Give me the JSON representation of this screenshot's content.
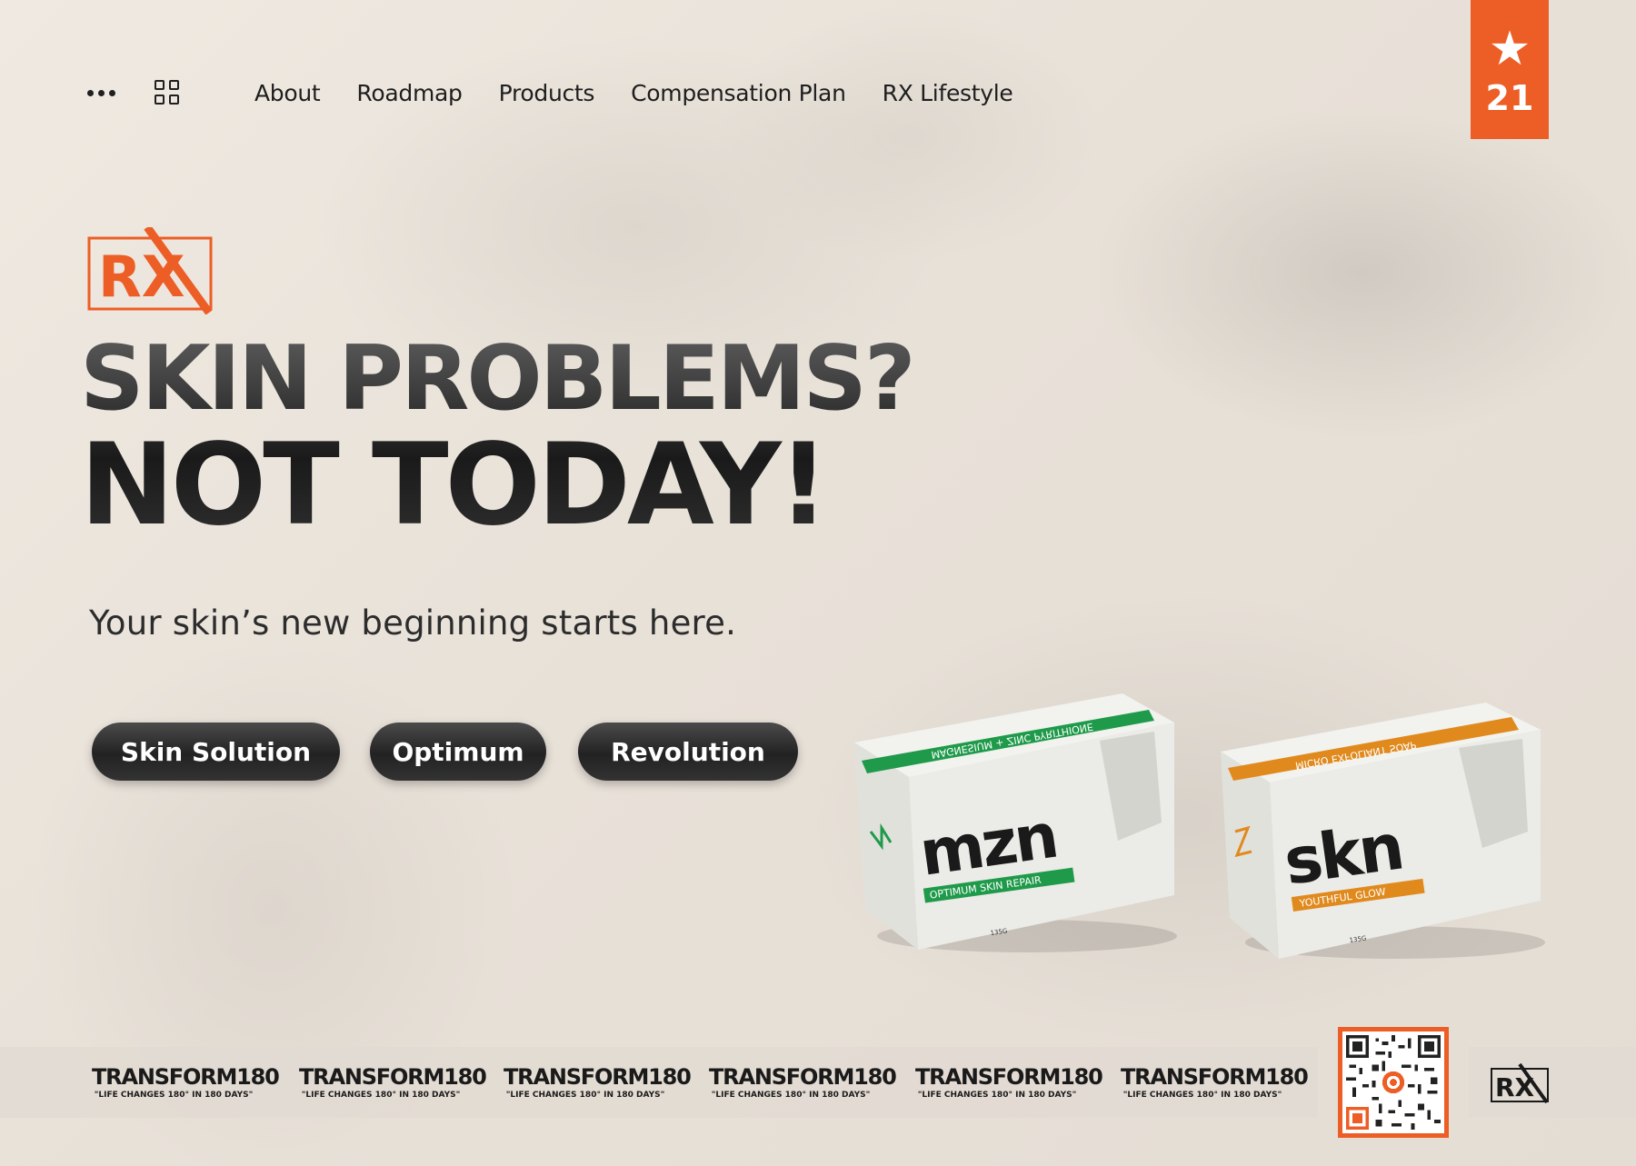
{
  "nav": {
    "links": [
      "About",
      "Roadmap",
      "Products",
      "Compensation Plan",
      "RX Lifestyle"
    ]
  },
  "rating_badge": {
    "value": "21",
    "icon": "star-icon"
  },
  "hero": {
    "logo_text": "RX",
    "headline_line1": "SKIN PROBLEMS?",
    "headline_line2": "NOT TODAY!",
    "tagline": "Your skin’s new beginning starts here."
  },
  "buttons": [
    "Skin Solution",
    "Optimum",
    "Revolution"
  ],
  "products": [
    {
      "brand": "mzn",
      "subtitle": "OPTIMUM SKIN REPAIR",
      "band_text": "MAGNESIUM + ZINC PYRITHIONE",
      "weight": "135G",
      "accent": "#1f9a4a"
    },
    {
      "brand": "skn",
      "subtitle": "YOUTHFUL GLOW",
      "band_text": "MICRO EXFOLIANT SOAP",
      "weight": "135G",
      "accent": "#e08a1e"
    }
  ],
  "transform_items": [
    {
      "title": "TRANSFORM180",
      "sub": "\"LIFE CHANGES 180° IN 180 DAYS\""
    },
    {
      "title": "TRANSFORM180",
      "sub": "\"LIFE CHANGES 180° IN 180 DAYS\""
    },
    {
      "title": "TRANSFORM180",
      "sub": "\"LIFE CHANGES 180° IN 180 DAYS\""
    },
    {
      "title": "TRANSFORM180",
      "sub": "\"LIFE CHANGES 180° IN 180 DAYS\""
    },
    {
      "title": "TRANSFORM180",
      "sub": "\"LIFE CHANGES 180° IN 180 DAYS\""
    },
    {
      "title": "TRANSFORM180",
      "sub": "\"LIFE CHANGES 180° IN 180 DAYS\""
    }
  ],
  "footer_logo_text": "RX",
  "colors": {
    "accent": "#ec5e25",
    "background": "#ebe5dc",
    "text": "#1f1f1f",
    "mzn_green": "#1f9a4a",
    "skn_orange": "#e08a1e"
  }
}
